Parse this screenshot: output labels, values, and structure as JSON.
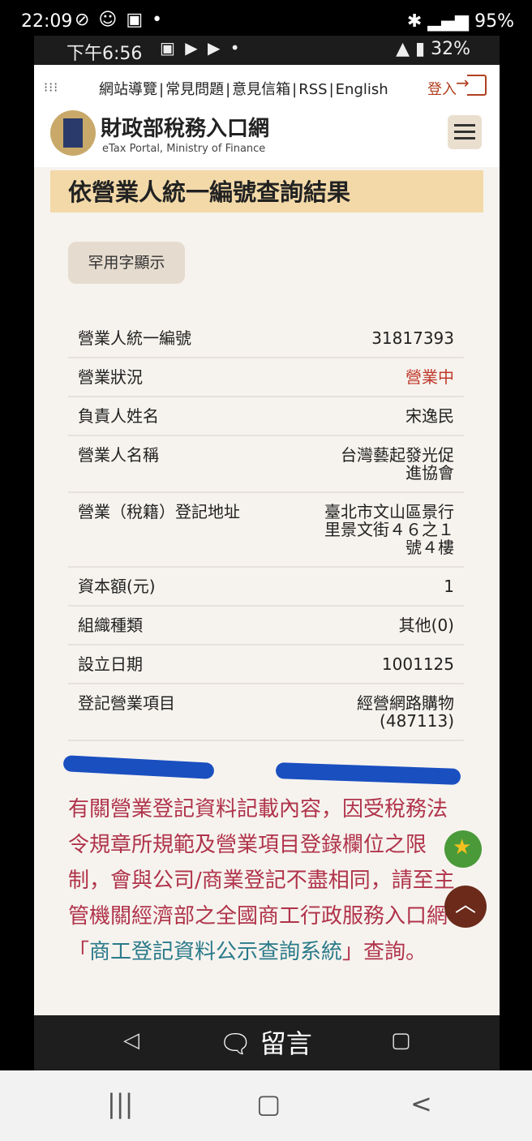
{
  "outer_status": {
    "time": "22:09",
    "battery": "95%"
  },
  "inner_status": {
    "time": "下午6:56",
    "battery": "32%"
  },
  "header": {
    "links": [
      "網站導覽",
      "常見問題",
      "意見信箱",
      "RSS",
      "English"
    ],
    "login": "登入",
    "brand_title": "財政部稅務入口網",
    "brand_subtitle": "eTax Portal, Ministry of Finance"
  },
  "page": {
    "title": "依營業人統一編號查詢結果",
    "rare_char_button": "罕用字顯示"
  },
  "rows": [
    {
      "label": "營業人統一編號",
      "value": "31817393"
    },
    {
      "label": "營業狀況",
      "value": "營業中"
    },
    {
      "label": "負責人姓名",
      "value": "宋逸民"
    },
    {
      "label": "營業人名稱",
      "value": "台灣藝起發光促進協會"
    },
    {
      "label": "營業（稅籍）登記地址",
      "value": "臺北市文山區景行里景文街４６之１號４樓"
    },
    {
      "label": "資本額(元)",
      "value": "1"
    },
    {
      "label": "組織種類",
      "value": "其他(0)"
    },
    {
      "label": "設立日期",
      "value": "1001125"
    },
    {
      "label": "登記營業項目",
      "value": "經營網路購物(487113)"
    }
  ],
  "notice": {
    "text": "有關營業登記資料記載內容，因受稅務法令規章所規範及營業項目登錄欄位之限制，會與公司/商業登記不盡相同，請至主管機關經濟部之全國商工行政服務入口網「",
    "link": "商工登記資料公示查詢系統",
    "tail": "」查詢。"
  },
  "footer": {
    "comment": "留言"
  },
  "colors": {
    "title_bg": "#f3d9a8",
    "status_red": "#c0392b",
    "notice": "#b0334a",
    "link": "#2a7a8a"
  }
}
